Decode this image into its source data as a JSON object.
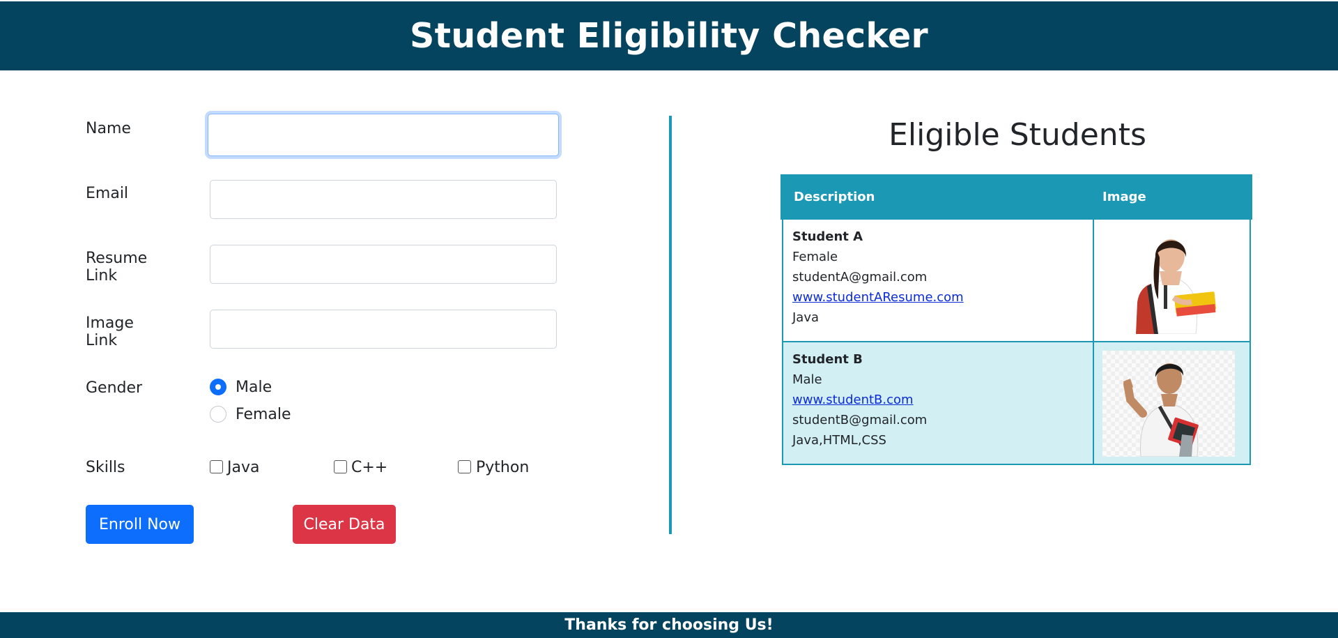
{
  "header": {
    "title": "Student Eligibility Checker"
  },
  "form": {
    "fields": [
      {
        "label": "Name",
        "value": ""
      },
      {
        "label": "Email",
        "value": ""
      },
      {
        "label": "Resume Link",
        "value": ""
      },
      {
        "label": "Image Link",
        "value": ""
      }
    ],
    "gender": {
      "label": "Gender",
      "options": [
        "Male",
        "Female"
      ],
      "selected": "Male"
    },
    "skills": {
      "label": "Skills",
      "options": [
        "Java",
        "C++",
        "Python"
      ]
    },
    "buttons": {
      "enroll": "Enroll Now",
      "clear": "Clear Data"
    }
  },
  "eligible": {
    "title": "Eligible Students",
    "columns": [
      "Description",
      "Image"
    ],
    "rows": [
      {
        "name": "Student A",
        "lines": [
          "Female",
          "studentA@gmail.com",
          "www.studentAResume.com",
          "Java"
        ]
      },
      {
        "name": "Student B",
        "lines": [
          "Male",
          "www.studentB.com",
          "studentB@gmail.com",
          "Java,HTML,CSS"
        ]
      }
    ]
  },
  "footer": {
    "text": "Thanks for choosing Us!"
  },
  "colors": {
    "header_bg": "#05445e",
    "accent": "#1a98b4",
    "primary_button": "#0d6efd",
    "danger_button": "#dc3545",
    "alt_row": "#d2f0f4"
  }
}
